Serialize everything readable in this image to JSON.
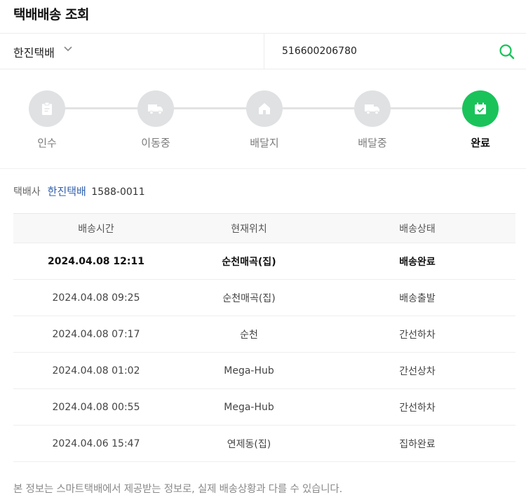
{
  "page": {
    "title": "택배배송 조회"
  },
  "search": {
    "carrier": "한진택배",
    "tracking_number": "516600206780"
  },
  "colors": {
    "accent": "#19c35a",
    "link": "#2f5fad",
    "inactive_step": "#dfe1e3"
  },
  "steps": [
    {
      "label": "인수",
      "icon": "clipboard-icon"
    },
    {
      "label": "이동중",
      "icon": "truck-icon"
    },
    {
      "label": "배달지",
      "icon": "house-icon"
    },
    {
      "label": "배달중",
      "icon": "truck-icon"
    },
    {
      "label": "완료",
      "icon": "calendar-check-icon"
    }
  ],
  "current_step": 5,
  "company": {
    "label": "택배사",
    "name": "한진택배",
    "phone": "1588-0011"
  },
  "table": {
    "headers": [
      "배송시간",
      "현재위치",
      "배송상태"
    ],
    "rows": [
      {
        "time": "2024.04.08 12:11",
        "location": "순천매곡(집)",
        "status": "배송완료"
      },
      {
        "time": "2024.04.08 09:25",
        "location": "순천매곡(집)",
        "status": "배송출발"
      },
      {
        "time": "2024.04.08 07:17",
        "location": "순천",
        "status": "간선하차"
      },
      {
        "time": "2024.04.08 01:02",
        "location": "Mega-Hub",
        "status": "간선상차"
      },
      {
        "time": "2024.04.08 00:55",
        "location": "Mega-Hub",
        "status": "간선하차"
      },
      {
        "time": "2024.04.06 15:47",
        "location": "연제동(집)",
        "status": "집하완료"
      }
    ]
  },
  "notice": "본 정보는 스마트택배에서 제공받는 정보로, 실제 배송상황과 다를 수 있습니다."
}
